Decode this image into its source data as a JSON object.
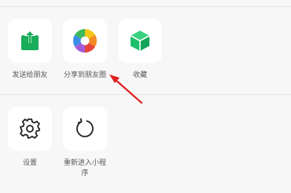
{
  "colors": {
    "background": "#f7f7f7",
    "tile": "#ffffff",
    "share_green": "#1aad5a",
    "cube_green": "#1dbf6d",
    "label": "#5a5a5a",
    "annotation_arrow": "#e02020"
  },
  "sheet": {
    "share_row": [
      {
        "label": "发送给朋友",
        "icon": "share-upload-icon"
      },
      {
        "label": "分享到朋友圈",
        "icon": "moments-aperture-icon"
      },
      {
        "label": "收藏",
        "icon": "favorite-cube-icon"
      }
    ],
    "action_row": [
      {
        "label": "设置",
        "icon": "gear-icon"
      },
      {
        "label": "重新进入小程序",
        "icon": "reload-icon"
      }
    ]
  },
  "annotation": {
    "icon": "red-pointer-arrow-icon"
  }
}
